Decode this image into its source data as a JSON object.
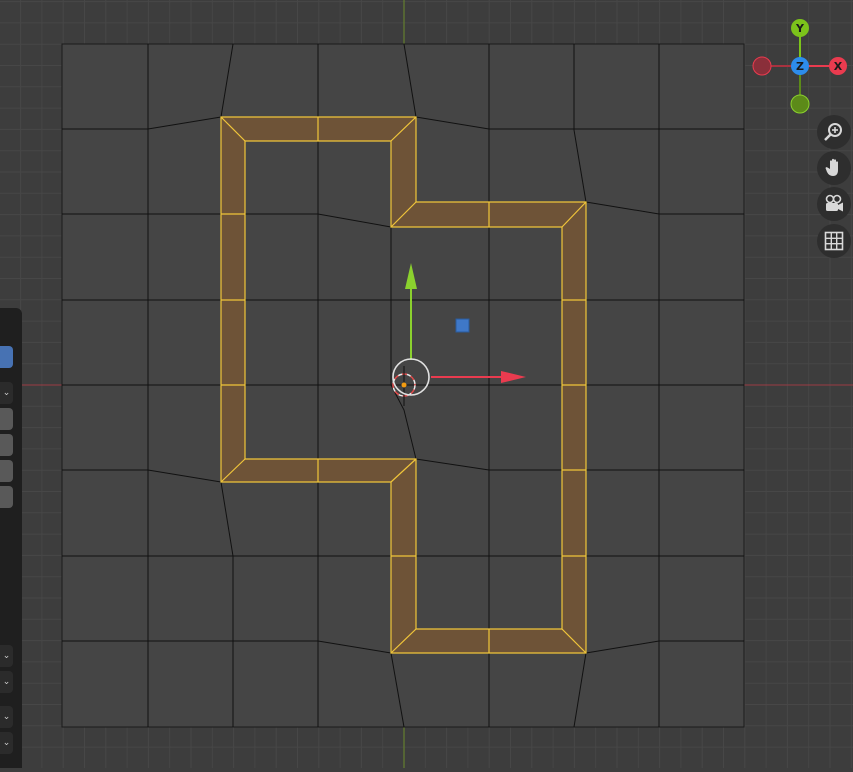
{
  "gizmo": {
    "axis_y_label": "Y",
    "axis_z_label": "Z",
    "axis_x_label": "X",
    "colors": {
      "x": "#ea3b4f",
      "y": "#7cc31b",
      "z": "#2d8ceb"
    }
  },
  "nav_tools": [
    {
      "icon": "zoom-icon"
    },
    {
      "icon": "hand-icon"
    },
    {
      "icon": "camera-icon"
    },
    {
      "icon": "grid-icon"
    }
  ],
  "colors": {
    "background": "#3d3d3d",
    "mesh_face": "#454545",
    "selected_face": "#6e5337",
    "selected_edge": "#f0c53a",
    "grid_line": "#4a4a4a"
  }
}
